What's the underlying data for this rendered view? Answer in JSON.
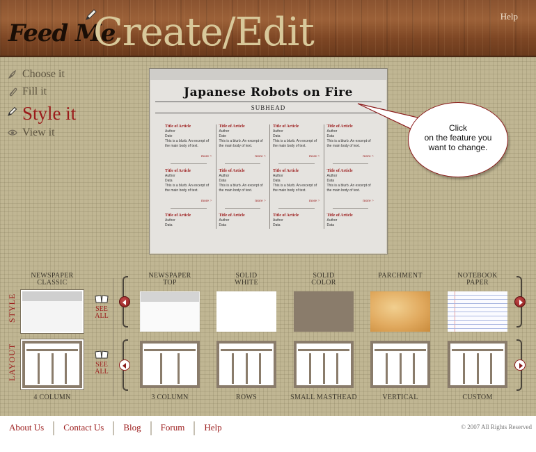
{
  "header": {
    "logo_text": "Feed Me",
    "title": "Create/Edit",
    "help_label": "Help"
  },
  "steps": [
    {
      "label": "Choose it",
      "icon": "pen-nib-icon"
    },
    {
      "label": "Fill it",
      "icon": "paperclip-icon"
    },
    {
      "label": "Style it",
      "icon": "pencil-icon",
      "active": true
    },
    {
      "label": "View it",
      "icon": "eye-icon"
    }
  ],
  "preview": {
    "title": "Japanese Robots on Fire",
    "subhead": "SUBHEAD",
    "articles": [
      {
        "title": "Title of Article",
        "author": "Author",
        "date": "Date",
        "blurb": "This is a blurb. An excerpt of the main body of text.",
        "more": "more >"
      },
      {
        "title": "Title of Article",
        "author": "Author",
        "date": "Date",
        "blurb": "This is a blurb. An excerpt of the main body of text.",
        "more": "more >"
      },
      {
        "title": "Title of Article",
        "author": "Author",
        "date": "Data",
        "blurb": "This is a blurb. An excerpt of the main body of text.",
        "more": "more >"
      },
      {
        "title": "Title of Article",
        "author": "Author",
        "date": "Data",
        "blurb": "This is a blurb. An excerpt of the main body of text.",
        "more": "more >"
      },
      {
        "title": "Title of Article",
        "author": "Author",
        "date": "Data",
        "blurb": "This is a blurb. An excerpt of the main body of text.",
        "more": "more >"
      },
      {
        "title": "Title of Article",
        "author": "Author",
        "date": "Data",
        "blurb": "This is a blurb. An excerpt of the main body of text.",
        "more": "more >"
      },
      {
        "title": "Title of Article",
        "author": "Author",
        "date": "Data",
        "blurb": "This is a blurb. An excerpt of the main body of text.",
        "more": "more >"
      },
      {
        "title": "Title of Article",
        "author": "Author",
        "date": "Data",
        "blurb": "This is a blurb. An excerpt of the main body of text.",
        "more": "more >"
      },
      {
        "title": "Title of Article",
        "author": "Author",
        "date": "Data"
      },
      {
        "title": "Title of Article",
        "author": "Author",
        "date": "Data"
      },
      {
        "title": "Title of Article",
        "author": "Author",
        "date": "Data"
      },
      {
        "title": "Title of Article",
        "author": "Author",
        "date": "Data"
      }
    ]
  },
  "callout": {
    "line1": "Click",
    "line2": "on the feature you",
    "line3": "want to change."
  },
  "selector": {
    "style_row_label": "STYLE",
    "layout_row_label": "LAYOUT",
    "see_all_line1": "SEE",
    "see_all_line2": "ALL",
    "current_style": {
      "line1": "NEWSPAPER",
      "line2": "CLASSIC"
    },
    "current_layout": "4 COLUMN",
    "styles": [
      {
        "line1": "NEWSPAPER",
        "line2": "TOP"
      },
      {
        "line1": "SOLID",
        "line2": "WHITE"
      },
      {
        "line1": "SOLID",
        "line2": "COLOR"
      },
      {
        "line1": "PARCHMENT",
        "line2": ""
      },
      {
        "line1": "NOTEBOOK",
        "line2": "PAPER"
      }
    ],
    "layouts": [
      "3 COLUMN",
      "ROWS",
      "SMALL MASTHEAD",
      "VERTICAL",
      "CUSTOM"
    ],
    "colors": {
      "accent": "#9b1a1a",
      "solid_color": "#8a7c6b"
    }
  },
  "footer": {
    "links": [
      "About Us",
      "Contact Us",
      "Blog",
      "Forum",
      "Help"
    ],
    "copyright": "© 2007 All Rights Reserved"
  }
}
